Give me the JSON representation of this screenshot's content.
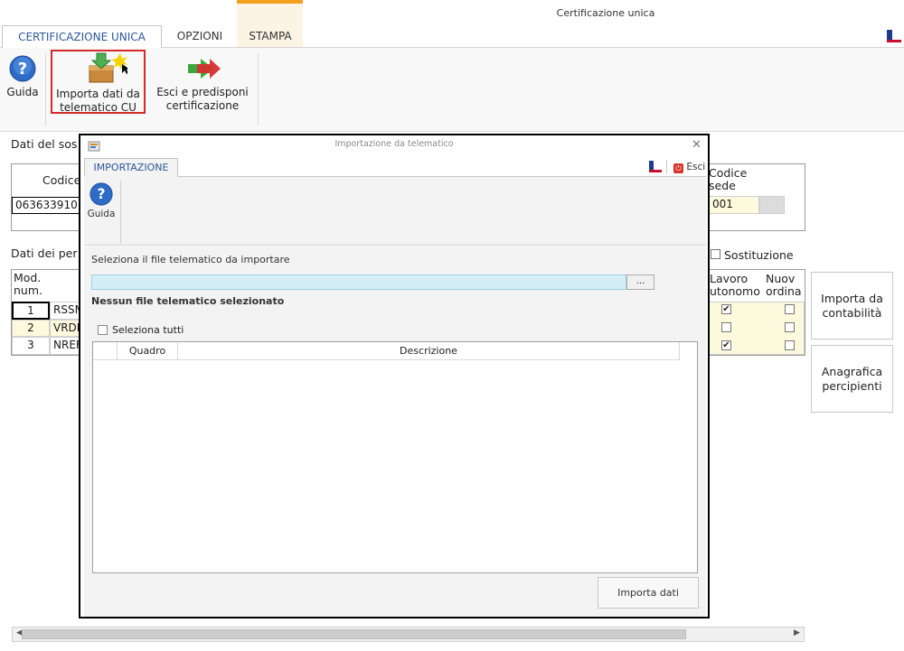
{
  "window": {
    "title": "Certificazione unica"
  },
  "ribbon": {
    "tabs": [
      "CERTIFICAZIONE UNICA",
      "OPZIONI",
      "STAMPA"
    ],
    "guida_label": "Guida",
    "importa_line1": "Importa dati da",
    "importa_line2": "telematico CU",
    "esci_line1": "Esci e predisponi",
    "esci_line2": "certificazione"
  },
  "background": {
    "sostituto_label": "Dati del sos",
    "codice_header": "Codice",
    "codice_value": "063633910",
    "codice_sede_line1": "Codice",
    "codice_sede_line2": "sede",
    "sede_value": "001",
    "percipienti_label": "Dati dei per",
    "sostituzione_label": "Sostituzione",
    "mod_header_line1": "Mod.",
    "mod_header_line2": "num.",
    "lavoro_line1": "Lavoro",
    "lavoro_line2": "utonomo",
    "nuova_line1": "Nuov",
    "nuova_line2": "ordina",
    "rows": [
      {
        "num": "1",
        "name": "RSSM",
        "lavoro": true,
        "nuova": false
      },
      {
        "num": "2",
        "name": "VRDM",
        "lavoro": false,
        "nuova": false
      },
      {
        "num": "3",
        "name": "NREF",
        "lavoro": true,
        "nuova": false
      }
    ]
  },
  "side_buttons": {
    "importa_cont_line1": "Importa da",
    "importa_cont_line2": "contabilità",
    "anagrafica_line1": "Anagrafica",
    "anagrafica_line2": "percipienti"
  },
  "modal": {
    "title": "Importazione da telematico",
    "tab": "IMPORTAZIONE",
    "guida_label": "Guida",
    "esci_label": "Esci",
    "select_prompt": "Seleziona il file telematico da importare",
    "file_value": "",
    "browse_label": "...",
    "no_file_msg": "Nessun file telematico selezionato",
    "select_all_label": "Seleziona tutti",
    "columns": [
      "Quadro",
      "Descrizione"
    ],
    "import_button": "Importa dati"
  },
  "colors": {
    "accent": "#2b579a",
    "stampa": "#f4a01c",
    "highlight": "#d42a2a",
    "input_bg": "#d4eef7"
  }
}
